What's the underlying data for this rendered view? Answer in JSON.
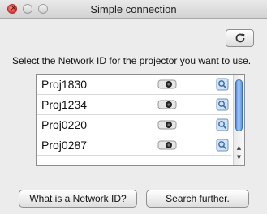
{
  "window": {
    "title": "Simple connection"
  },
  "instruction": "Select the Network ID for the projector you want to use.",
  "projectors": [
    {
      "label": "Proj1830"
    },
    {
      "label": "Proj1234"
    },
    {
      "label": "Proj0220"
    },
    {
      "label": "Proj0287"
    }
  ],
  "buttons": {
    "what_is": "What is a Network ID?",
    "search": "Search further."
  },
  "icons": {
    "refresh": "refresh-icon",
    "projector": "projector-icon",
    "info": "info-icon"
  },
  "colors": {
    "scroll_thumb": "#5a96e6",
    "close_button": "#e0443a"
  }
}
